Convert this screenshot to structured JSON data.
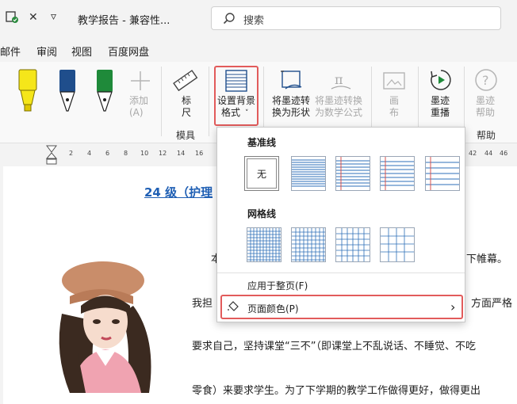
{
  "titlebar": {
    "doc_title": "教学报告 - 兼容性...",
    "search_placeholder": "搜索",
    "close_glyph": "✕",
    "more_glyph": "▿"
  },
  "menu": {
    "tabs": [
      "邮件",
      "审阅",
      "视图",
      "百度网盘"
    ]
  },
  "ribbon": {
    "add_label": "添加",
    "add_sub": "(A)",
    "ruler_label": "标",
    "ruler_label2": "尺",
    "group_template": "模具",
    "page_bg_format_1": "设置背景",
    "page_bg_format_2": "格式",
    "ink_to_shape_1": "将墨迹转",
    "ink_to_shape_2": "换为形状",
    "ink_to_math_1": "将墨迹转换",
    "ink_to_math_2": "为数学公式",
    "canvas_1": "画",
    "canvas_2": "布",
    "replay_1": "墨迹",
    "replay_2": "重播",
    "help_1": "墨迹",
    "help_2": "帮助",
    "group_help": "帮助",
    "colors": {
      "pen_yellow": "#f5e61a",
      "pen_blue": "#1f4e8c",
      "pen_green": "#1f8a3a",
      "accent_red": "#e25b5b"
    }
  },
  "ruler": {
    "ticks": [
      "2",
      "4",
      "6",
      "8",
      "10",
      "12",
      "14",
      "16",
      "42",
      "44",
      "46"
    ]
  },
  "document": {
    "title_text": "24 级（护理",
    "line1_left": "本",
    "line1_right": "下帷幕。",
    "line2_left": "我担",
    "line2_right": "方面严格",
    "line3": "要求自己，坚持课堂“三不”（即课堂上不乱说话、不睡觉、不吃",
    "line4": "零食）来要求学生。为了下学期的教学工作做得更好，做得更出"
  },
  "dropdown": {
    "baseline_heading": "基准线",
    "none_label": "无",
    "grid_heading": "网格线",
    "apply_whole_page": "应用于整页(F)",
    "page_color": "页面颜色(P)",
    "page_color_arrow": "›"
  }
}
